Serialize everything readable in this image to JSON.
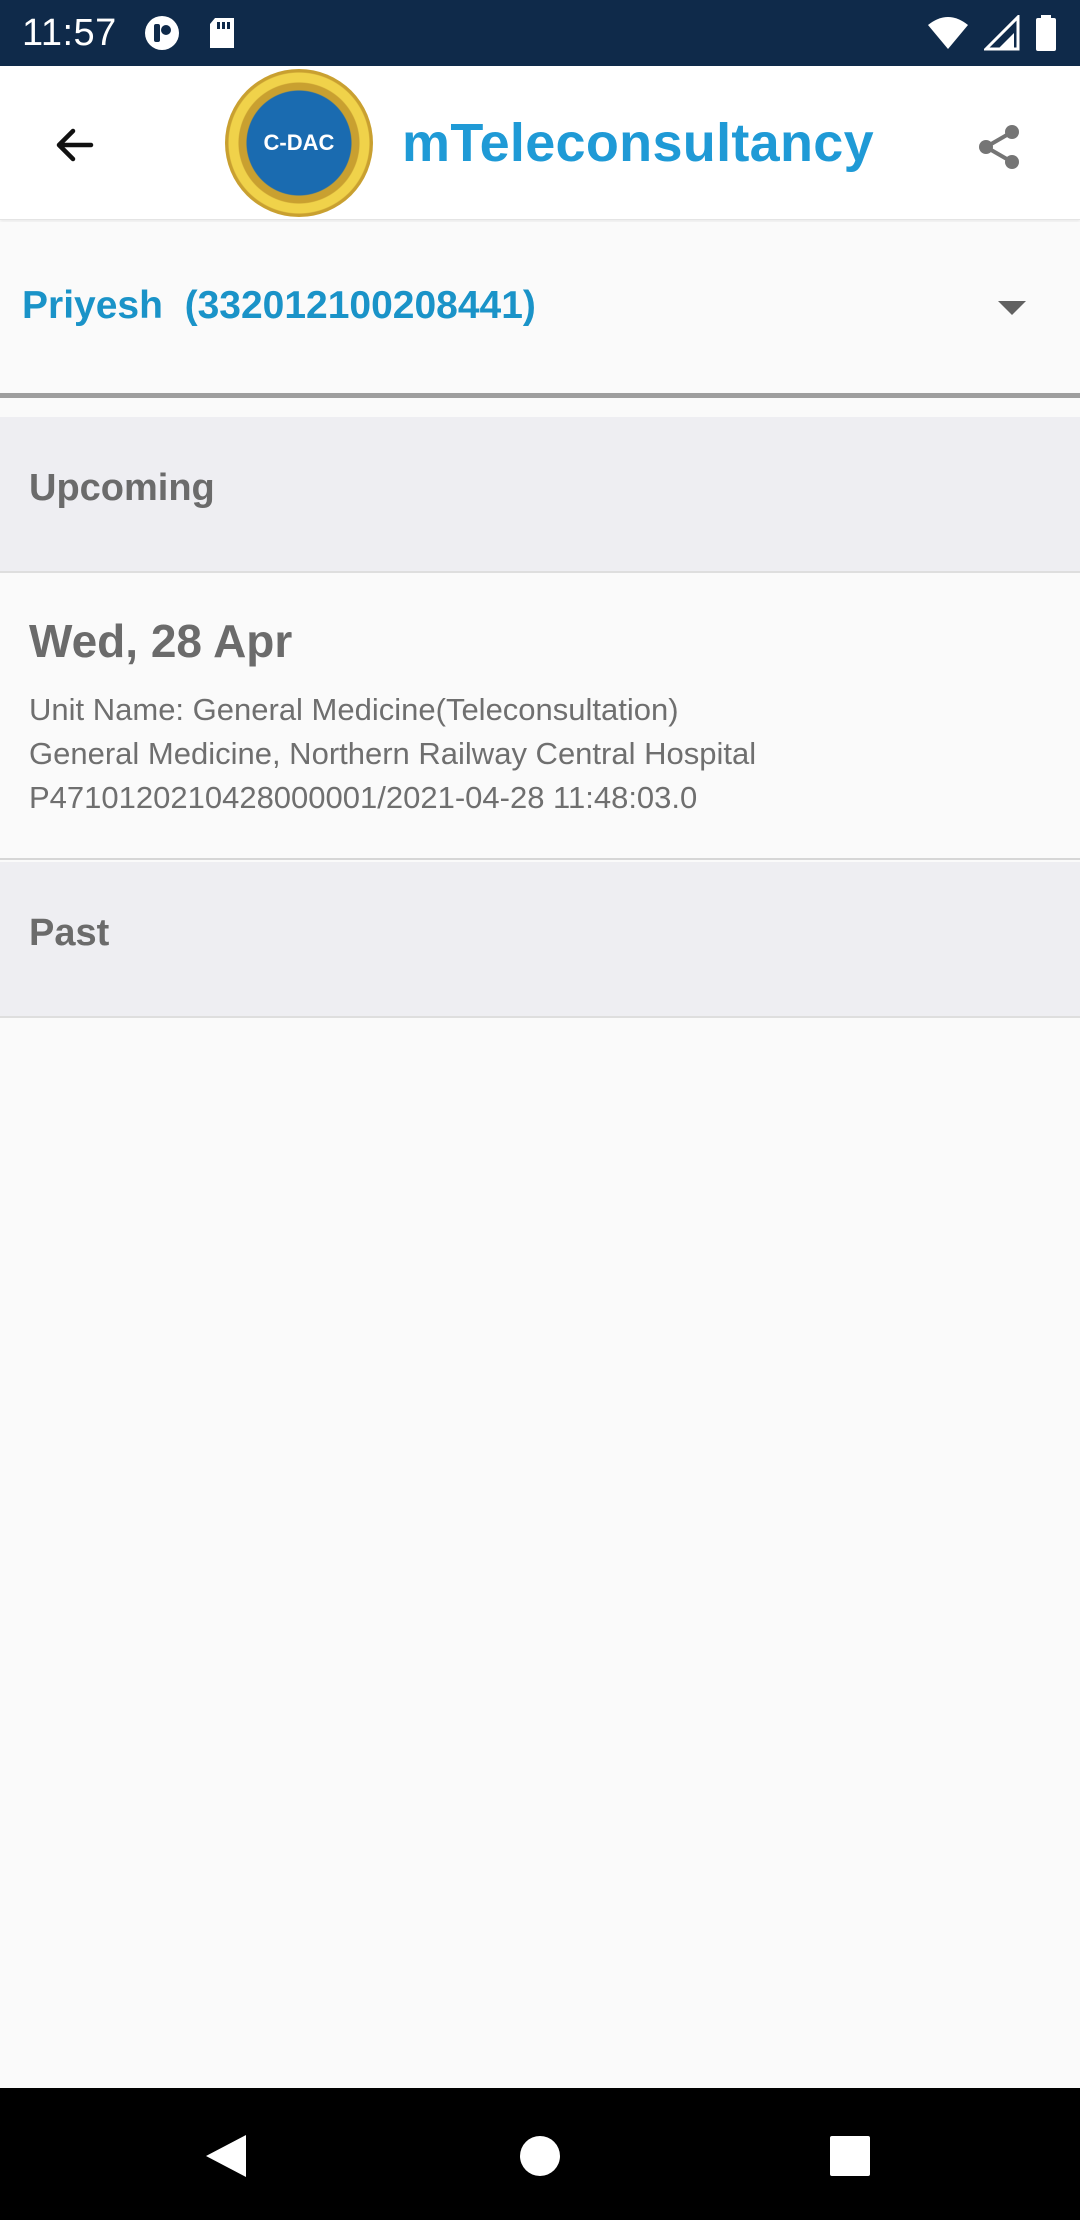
{
  "status_bar": {
    "time": "11:57",
    "left_icons": [
      "notification-app-icon",
      "sd-card-icon"
    ],
    "right_icons": [
      "wifi-icon",
      "cell-signal-icon",
      "battery-icon"
    ]
  },
  "app_bar": {
    "title": "mTeleconsultancy",
    "logo_text": "C-DAC",
    "back_icon": "arrow-back-icon",
    "share_icon": "share-icon"
  },
  "patient_selector": {
    "value": "Priyesh  (332012100208441)"
  },
  "sections": {
    "upcoming": "Upcoming",
    "past": "Past"
  },
  "appointments": [
    {
      "date": "Wed, 28 Apr",
      "unit": "Unit Name: General Medicine(Teleconsultation)",
      "department": "General Medicine, Northern Railway Central Hospital",
      "reference": "P47101202104280000​01/2021-04-28 11:48:03.0"
    }
  ],
  "nav_bar": {
    "icons": [
      "back-triangle-icon",
      "home-circle-icon",
      "recents-square-icon"
    ]
  },
  "colors": {
    "status_bar": "#0f2a4a",
    "title_accent": "#1f9ad6",
    "patient_text": "#1a93c8",
    "section_bg": "#eeeef2"
  }
}
